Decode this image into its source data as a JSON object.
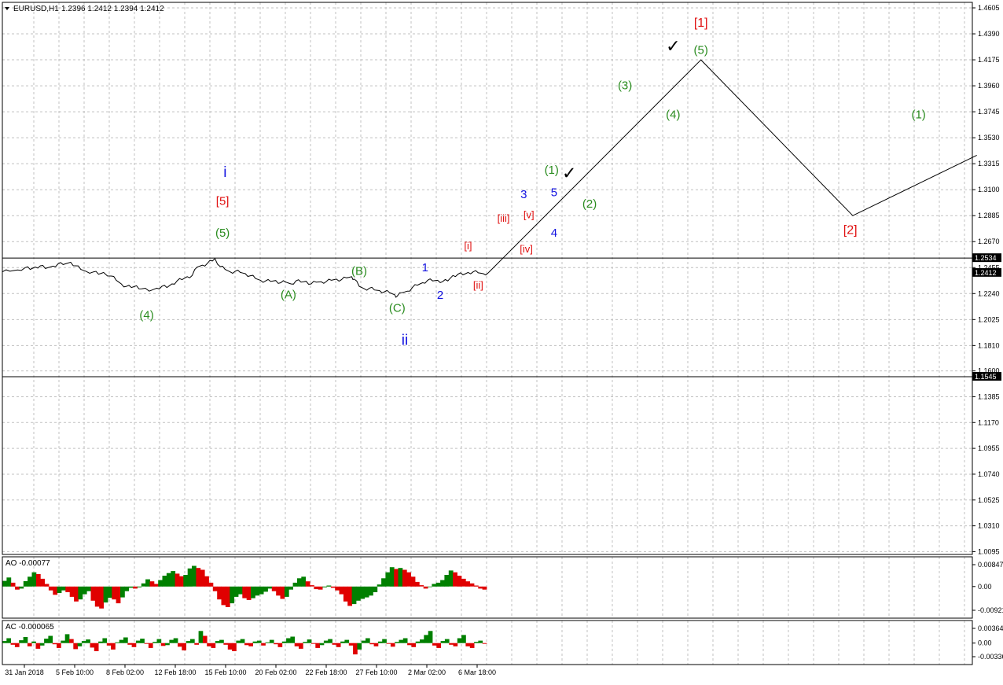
{
  "header": {
    "symbol": "EURUSD,H1",
    "ohlc": "1.2396 1.2412 1.2394 1.2412"
  },
  "colors": {
    "green": "#2a8c1f",
    "red": "#e01010",
    "blue": "#1010e0",
    "grid": "#c0c0c0",
    "bull_bar": "#008000",
    "bear_bar": "#e00000"
  },
  "chart_data": [
    {
      "type": "line",
      "name": "price",
      "ylim": [
        1.1545,
        1.4605
      ],
      "price_ticks": [
        "1.4605",
        "1.4390",
        "1.4175",
        "1.3960",
        "1.3745",
        "1.3530",
        "1.3315",
        "1.3100",
        "1.2885",
        "1.2670",
        "1.2455",
        "1.2240",
        "1.2025",
        "1.1810",
        "1.1600",
        "1.1385",
        "1.1170",
        "1.0955",
        "1.0740",
        "1.0525",
        "1.0310",
        "1.0095"
      ],
      "price_tick_values": [
        1.4605,
        1.439,
        1.4175,
        1.396,
        1.3745,
        1.353,
        1.3315,
        1.31,
        1.2885,
        1.267,
        1.2455,
        1.224,
        1.2025,
        1.181,
        1.16,
        1.1385,
        1.117,
        1.0955,
        1.074,
        1.0525,
        1.031,
        1.0095
      ],
      "price_levels": [
        {
          "label": "1.2534",
          "value": 1.2534
        },
        {
          "label": "1.2412",
          "value": 1.2412
        },
        {
          "label": "1.1545",
          "value": 1.1545
        }
      ],
      "time_labels": [
        "31 Jan 2018",
        "5 Feb 10:00",
        "8 Feb 02:00",
        "12 Feb 18:00",
        "15 Feb 10:00",
        "20 Feb 02:00",
        "22 Feb 18:00",
        "27 Feb 10:00",
        "2 Mar 02:00",
        "6 Mar 18:00"
      ],
      "price_path": [
        [
          0,
          1.242
        ],
        [
          3,
          1.2425
        ],
        [
          6,
          1.2436
        ],
        [
          9,
          1.2455
        ],
        [
          11,
          1.244
        ],
        [
          13,
          1.246
        ],
        [
          15,
          1.247
        ],
        [
          17,
          1.2448
        ],
        [
          20,
          1.2467
        ],
        [
          22,
          1.2486
        ],
        [
          24,
          1.248
        ],
        [
          27,
          1.25
        ],
        [
          29,
          1.247
        ],
        [
          31,
          1.244
        ],
        [
          33,
          1.2425
        ],
        [
          36,
          1.242
        ],
        [
          38,
          1.24
        ],
        [
          40,
          1.2415
        ],
        [
          43,
          1.2385
        ],
        [
          45,
          1.235
        ],
        [
          47,
          1.232
        ],
        [
          49,
          1.23
        ],
        [
          51,
          1.229
        ],
        [
          53,
          1.2305
        ],
        [
          55,
          1.228
        ],
        [
          58,
          1.226
        ],
        [
          61,
          1.2285
        ],
        [
          63,
          1.23
        ],
        [
          65,
          1.229
        ],
        [
          67,
          1.232
        ],
        [
          69,
          1.2345
        ],
        [
          71,
          1.2355
        ],
        [
          73,
          1.238
        ],
        [
          75,
          1.239
        ],
        [
          77,
          1.246
        ],
        [
          79,
          1.2475
        ],
        [
          81,
          1.249
        ],
        [
          83,
          1.251
        ],
        [
          84,
          1.253
        ],
        [
          86,
          1.2465
        ],
        [
          88,
          1.244
        ],
        [
          90,
          1.242
        ],
        [
          92,
          1.2425
        ],
        [
          94,
          1.2415
        ],
        [
          96,
          1.2405
        ],
        [
          98,
          1.2388
        ],
        [
          100,
          1.2365
        ],
        [
          102,
          1.235
        ],
        [
          104,
          1.2345
        ],
        [
          106,
          1.234
        ],
        [
          108,
          1.2348
        ],
        [
          110,
          1.233
        ],
        [
          112,
          1.2335
        ],
        [
          114,
          1.232
        ],
        [
          116,
          1.2345
        ],
        [
          118,
          1.2335
        ],
        [
          120,
          1.2342
        ],
        [
          122,
          1.232
        ],
        [
          124,
          1.2335
        ],
        [
          126,
          1.2338
        ],
        [
          128,
          1.234
        ],
        [
          130,
          1.235
        ],
        [
          132,
          1.236
        ],
        [
          134,
          1.2355
        ],
        [
          136,
          1.237
        ],
        [
          138,
          1.238
        ],
        [
          139,
          1.236
        ],
        [
          141,
          1.23
        ],
        [
          143,
          1.228
        ],
        [
          145,
          1.2285
        ],
        [
          147,
          1.227
        ],
        [
          149,
          1.2265
        ],
        [
          151,
          1.2255
        ],
        [
          153,
          1.2248
        ],
        [
          155,
          1.223
        ],
        [
          156,
          1.2218
        ],
        [
          158,
          1.2248
        ],
        [
          160,
          1.226
        ],
        [
          162,
          1.229
        ],
        [
          164,
          1.231
        ],
        [
          166,
          1.233
        ],
        [
          168,
          1.235
        ],
        [
          170,
          1.2345
        ],
        [
          172,
          1.235
        ],
        [
          174,
          1.234
        ],
        [
          176,
          1.2345
        ],
        [
          178,
          1.239
        ],
        [
          180,
          1.24
        ],
        [
          182,
          1.2395
        ],
        [
          184,
          1.2415
        ],
        [
          186,
          1.242
        ],
        [
          188,
          1.2412
        ],
        [
          190,
          1.2405
        ],
        [
          192,
          1.2412
        ]
      ],
      "projection_path": [
        [
          192,
          1.2412
        ],
        [
          276,
          1.4175
        ],
        [
          336,
          1.2885
        ],
        [
          385,
          1.3385
        ]
      ],
      "wave_labels": [
        {
          "text": "i",
          "t": 88,
          "p": 1.3205,
          "color": "blue",
          "size": 19
        },
        {
          "text": "[5]",
          "t": 87,
          "p": 1.2975,
          "color": "red",
          "size": 15
        },
        {
          "text": "(5)",
          "t": 87,
          "p": 1.271,
          "color": "green",
          "size": 15
        },
        {
          "text": "(4)",
          "t": 57,
          "p": 1.203,
          "color": "green",
          "size": 15
        },
        {
          "text": "(A)",
          "t": 113,
          "p": 1.22,
          "color": "green",
          "size": 15
        },
        {
          "text": "(B)",
          "t": 141,
          "p": 1.2395,
          "color": "green",
          "size": 15
        },
        {
          "text": "(C)",
          "t": 156,
          "p": 1.209,
          "color": "green",
          "size": 15
        },
        {
          "text": "ii",
          "t": 159,
          "p": 1.1815,
          "color": "blue",
          "size": 19
        },
        {
          "text": "1",
          "t": 167,
          "p": 1.2425,
          "color": "blue",
          "size": 15
        },
        {
          "text": "2",
          "t": 173,
          "p": 1.2195,
          "color": "blue",
          "size": 15
        },
        {
          "text": "[i]",
          "t": 184,
          "p": 1.2605,
          "color": "red",
          "size": 13
        },
        {
          "text": "[ii]",
          "t": 188,
          "p": 1.228,
          "color": "red",
          "size": 13
        },
        {
          "text": "[iii]",
          "t": 198,
          "p": 1.2835,
          "color": "red",
          "size": 13
        },
        {
          "text": "[iv]",
          "t": 207,
          "p": 1.258,
          "color": "red",
          "size": 13
        },
        {
          "text": "[v]",
          "t": 208,
          "p": 1.2865,
          "color": "red",
          "size": 13
        },
        {
          "text": "3",
          "t": 206,
          "p": 1.303,
          "color": "blue",
          "size": 15
        },
        {
          "text": "4",
          "t": 218,
          "p": 1.271,
          "color": "blue",
          "size": 15
        },
        {
          "text": "5",
          "t": 218,
          "p": 1.3045,
          "color": "blue",
          "size": 15
        },
        {
          "text": "(1)",
          "t": 217,
          "p": 1.323,
          "color": "green",
          "size": 15
        },
        {
          "text": "✓",
          "t": 224,
          "p": 1.319,
          "color": "black",
          "size": 22
        },
        {
          "text": "(2)",
          "t": 232,
          "p": 1.295,
          "color": "green",
          "size": 15
        },
        {
          "text": "(3)",
          "t": 246,
          "p": 1.393,
          "color": "green",
          "size": 15
        },
        {
          "text": "(4)",
          "t": 265,
          "p": 1.369,
          "color": "green",
          "size": 15
        },
        {
          "text": "✓",
          "t": 265,
          "p": 1.424,
          "color": "black",
          "size": 22
        },
        {
          "text": "(5)",
          "t": 276,
          "p": 1.4225,
          "color": "green",
          "size": 15
        },
        {
          "text": "[1]",
          "t": 276,
          "p": 1.445,
          "color": "red",
          "size": 16
        },
        {
          "text": "[2]",
          "t": 335,
          "p": 1.2735,
          "color": "red",
          "size": 16
        },
        {
          "text": "(1)",
          "t": 362,
          "p": 1.369,
          "color": "green",
          "size": 15
        }
      ]
    },
    {
      "type": "bar",
      "name": "AO",
      "label": "AO -0.00077",
      "ylim": [
        -0.00921,
        0.00847
      ],
      "ticks": [
        "0.00847",
        "0.00",
        "-0.00921"
      ],
      "tick_values": [
        0.00847,
        0,
        -0.00921
      ],
      "values": [
        0.0022,
        0.0035,
        0.0015,
        -0.0012,
        -0.0008,
        0.0021,
        0.0038,
        0.0055,
        0.0048,
        0.003,
        0.001,
        -0.0015,
        -0.0032,
        -0.0025,
        -0.0015,
        -0.0022,
        -0.004,
        -0.0058,
        -0.005,
        -0.003,
        -0.0018,
        -0.0055,
        -0.0078,
        -0.0085,
        -0.0062,
        -0.0044,
        -0.005,
        -0.0065,
        -0.0042,
        -0.0018,
        -0.0005,
        -0.0008,
        -0.0003,
        0.0012,
        0.0028,
        0.002,
        0.001,
        0.0025,
        0.0042,
        0.0052,
        0.006,
        0.005,
        0.004,
        0.0045,
        0.007,
        0.008,
        0.0072,
        0.0065,
        0.004,
        0.0015,
        -0.0018,
        -0.005,
        -0.0072,
        -0.008,
        -0.0065,
        -0.004,
        -0.003,
        -0.0045,
        -0.0052,
        -0.0045,
        -0.0035,
        -0.003,
        -0.002,
        -0.0008,
        -0.0018,
        -0.0035,
        -0.0048,
        -0.004,
        -0.0012,
        0.0015,
        0.0032,
        0.0038,
        0.002,
        0.0005,
        -0.001,
        -0.0012,
        -0.0003,
        0.0004,
        -0.0005,
        -0.0015,
        -0.003,
        -0.0058,
        -0.0075,
        -0.0068,
        -0.0055,
        -0.0048,
        -0.0042,
        -0.0035,
        -0.0022,
        0.0008,
        0.0032,
        0.0055,
        0.0075,
        0.0068,
        0.0072,
        0.0065,
        0.0055,
        0.0038,
        0.0018,
        0.0005,
        -0.0008,
        -0.0002,
        0.001,
        0.0015,
        0.0025,
        0.0045,
        0.0062,
        0.0055,
        0.0042,
        0.003,
        0.002,
        0.0012,
        0.0004,
        -0.0008,
        -0.0012
      ]
    },
    {
      "type": "bar",
      "name": "AC",
      "label": "AC -0.000065",
      "ylim": [
        -0.00336,
        0.00364
      ],
      "ticks": [
        "0.00364",
        "0.00",
        "-0.00336"
      ],
      "tick_values": [
        0.00364,
        0,
        -0.00336
      ],
      "values": [
        0.0005,
        0.0012,
        -0.0004,
        -0.001,
        0.0007,
        0.0015,
        -0.0008,
        0.0004,
        -0.0014,
        -0.0006,
        0.0011,
        0.0018,
        -0.0003,
        -0.0012,
        0.0006,
        0.0022,
        0.001,
        -0.0015,
        -0.0008,
        0.0005,
        0.0009,
        -0.0011,
        -0.002,
        0.0004,
        0.0012,
        -0.0006,
        -0.0016,
        0.0002,
        0.0008,
        0.0014,
        -0.0004,
        -0.001,
        0.0006,
        0.0011,
        -0.0002,
        -0.0012,
        0.0003,
        0.001,
        -0.0007,
        -0.0005,
        0.0008,
        0.0012,
        -0.0009,
        -0.0018,
        0.0005,
        0.001,
        -0.0004,
        0.003,
        0.0018,
        -0.0008,
        -0.0012,
        0.0005,
        0.0008,
        -0.0004,
        -0.0016,
        -0.002,
        0.0006,
        0.001,
        -0.0005,
        -0.0008,
        0.0004,
        0.0006,
        -0.0006,
        0.0002,
        0.0008,
        -0.0003,
        -0.001,
        0.0004,
        0.0012,
        0.0016,
        -0.0008,
        -0.0014,
        0.0003,
        0.0009,
        -0.0002,
        -0.0012,
        -0.0005,
        0.0006,
        0.001,
        -0.0004,
        -0.001,
        0.0004,
        0.0008,
        -0.0006,
        -0.0028,
        -0.0016,
        0.0006,
        0.0012,
        -0.0003,
        -0.0008,
        0.0004,
        0.001,
        -0.0002,
        -0.0009,
        0.0003,
        0.0008,
        0.0012,
        -0.0005,
        -0.001,
        0.0004,
        0.0009,
        0.002,
        0.003,
        -0.0006,
        -0.0012,
        0.0005,
        0.001,
        -0.0004,
        -0.0008,
        0.0012,
        0.002,
        -0.0008,
        -0.0012,
        0.0003,
        0.0006,
        -0.0002
      ]
    }
  ]
}
